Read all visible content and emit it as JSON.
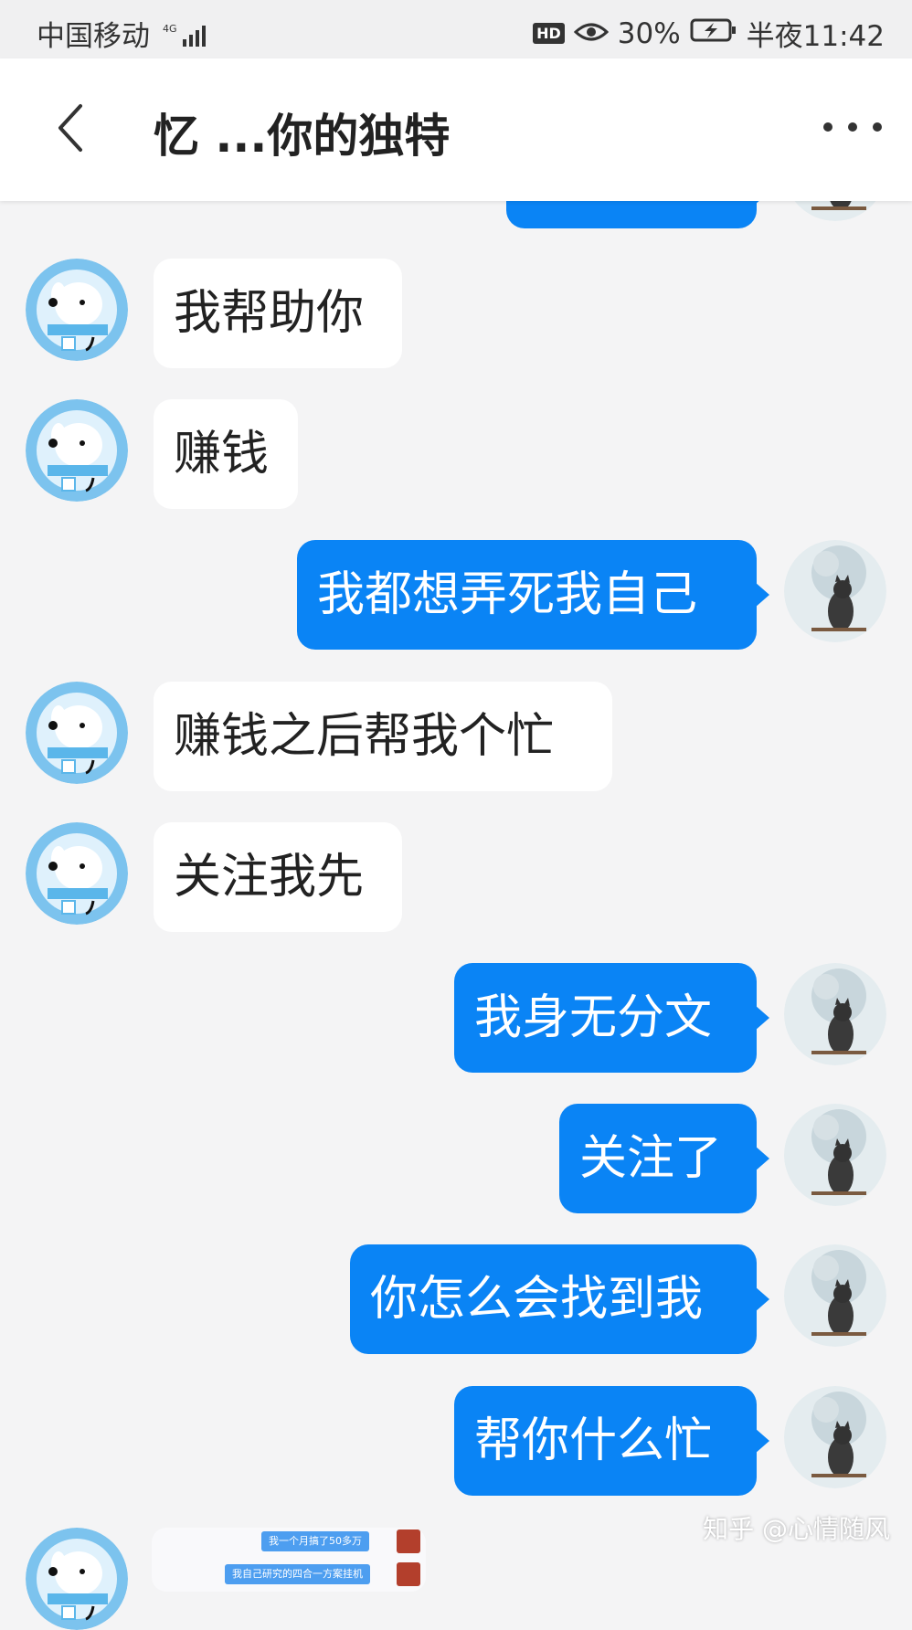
{
  "status_bar": {
    "carrier": "中国移动",
    "network": "4G",
    "hd": "HD",
    "battery": "30%",
    "time": "半夜11:42"
  },
  "header": {
    "title": "忆 ...你的独特"
  },
  "messages": [
    {
      "side": "in",
      "text": "我帮助你"
    },
    {
      "side": "in",
      "text": "赚钱"
    },
    {
      "side": "out",
      "text": "我都想弄死我自己"
    },
    {
      "side": "in",
      "text": "赚钱之后帮我个忙"
    },
    {
      "side": "in",
      "text": "关注我先"
    },
    {
      "side": "out",
      "text": "我身无分文"
    },
    {
      "side": "out",
      "text": "关注了"
    },
    {
      "side": "out",
      "text": "你怎么会找到我"
    },
    {
      "side": "out",
      "text": "帮你什么忙"
    }
  ],
  "image_preview": {
    "line1": "我一个月搞了50多万",
    "line2": "我自己研究的四合一方案挂机"
  },
  "watermark": "知乎 @心情随风",
  "colors": {
    "outgoing_bubble": "#0a84f5",
    "incoming_bubble": "#ffffff",
    "background": "#f4f4f5"
  }
}
